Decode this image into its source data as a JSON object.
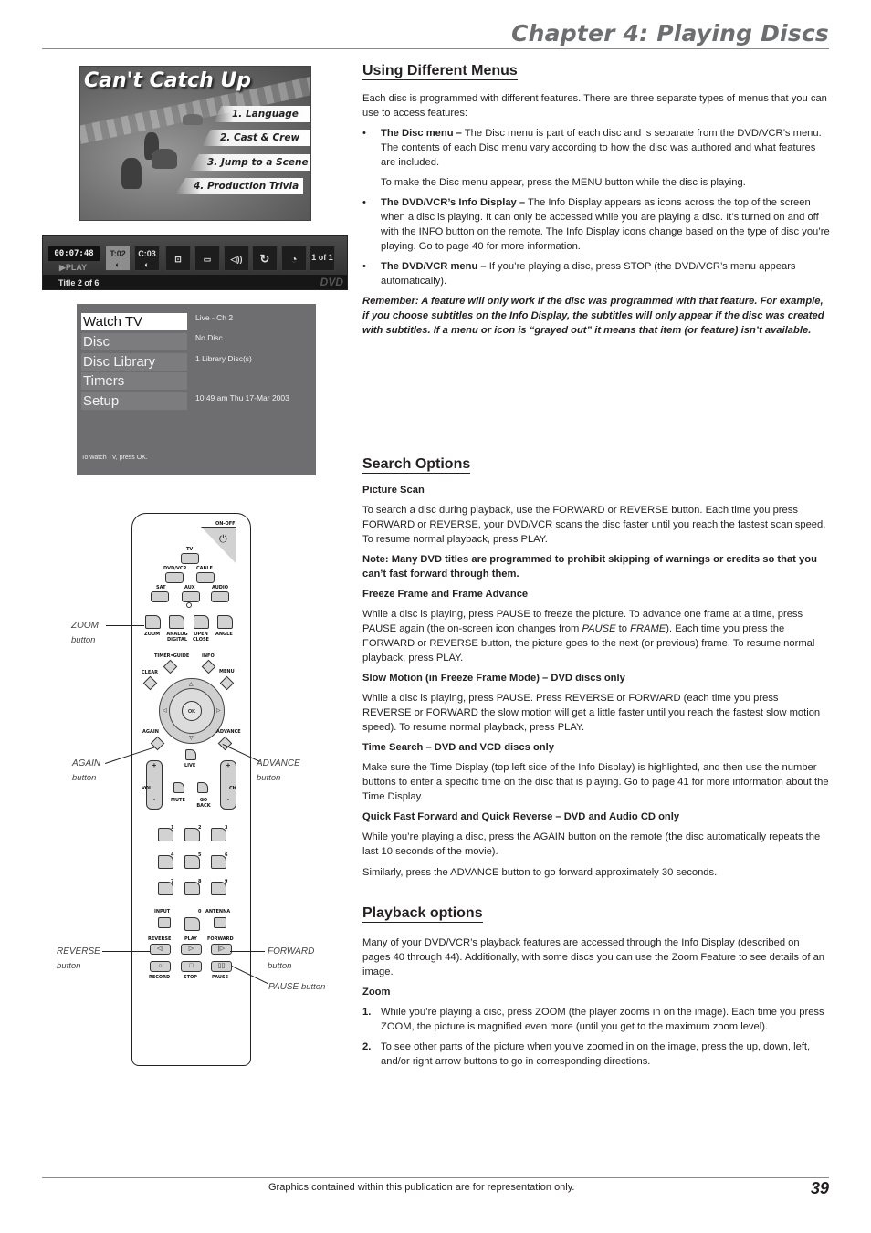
{
  "header": {
    "chapter_title": "Chapter 4: Playing Discs"
  },
  "disc_menu_image": {
    "title": "Can't Catch Up",
    "options": [
      "1. Language",
      "2. Cast & Crew",
      "3. Jump to a Scene",
      "4. Production Trivia"
    ]
  },
  "info_display_image": {
    "time": "00:07:48",
    "play_status": "▶PLAY",
    "title_chip": "T:02",
    "chapter_chip": "C:03",
    "angle_chip": "1 of 1",
    "footer_title": "Title 2 of 6",
    "logo": "DVD",
    "icons": [
      "title-icon",
      "chapter-icon",
      "zoom-icon",
      "subtitle-icon",
      "audio-icon",
      "repeat-icon",
      "timer-icon",
      "angle-icon"
    ]
  },
  "main_menu_image": {
    "items": [
      {
        "label": "Watch TV",
        "value": "Live - Ch 2",
        "active": true
      },
      {
        "label": "Disc",
        "value": "No Disc"
      },
      {
        "label": "Disc Library",
        "value": "1 Library Disc(s)"
      },
      {
        "label": "Timers",
        "value": ""
      },
      {
        "label": "Setup",
        "value": "10:49 am Thu 17-Mar 2003"
      }
    ],
    "hint": "To watch TV, press OK."
  },
  "remote": {
    "labels": {
      "on_off": "ON-OFF",
      "tv": "TV",
      "dvd_vcr": "DVD/VCR",
      "cable": "CABLE",
      "sat": "SAT",
      "aux": "AUX",
      "audio": "AUDIO",
      "zoom": "ZOOM",
      "analog_digital": "ANALOG DIGITAL",
      "open_close": "OPEN CLOSE",
      "angle": "ANGLE",
      "timer_guide": "TIMER•GUIDE",
      "info": "INFO",
      "clear": "CLEAR",
      "menu": "MENU",
      "ok": "OK",
      "again": "AGAIN",
      "advance": "ADVANCE",
      "live": "LIVE",
      "vol": "VOL",
      "ch": "CH",
      "mute": "MUTE",
      "go_back": "GO BACK",
      "input": "INPUT",
      "antenna": "ANTENNA",
      "reverse": "REVERSE",
      "play": "PLAY",
      "forward": "FORWARD",
      "record": "RECORD",
      "stop": "STOP",
      "pause": "PAUSE",
      "plus": "+",
      "minus": "-"
    },
    "digits": [
      "1",
      "2",
      "3",
      "4",
      "5",
      "6",
      "7",
      "8",
      "9",
      "0"
    ],
    "callouts": {
      "zoom": "ZOOM",
      "again": "AGAIN",
      "advance": "ADVANCE",
      "reverse": "REVERSE",
      "forward": "FORWARD",
      "pause": "PAUSE",
      "button_word": "button"
    }
  },
  "content": {
    "menus": {
      "heading": "Using Different Menus",
      "intro": "Each disc is programmed with different features. There are three separate types of menus that you can use to access features:",
      "bullets": [
        {
          "lead": "The Disc menu –",
          "text": " The Disc menu is part of each disc and is separate from the DVD/VCR’s menu. The contents of each Disc menu vary according to how the disc was authored and what features are included."
        },
        {
          "lead": "The DVD/VCR’s Info Display –",
          "text": " The Info Display appears as icons across the top of the screen when a disc is playing. It can only be accessed while you are playing a disc. It’s turned on and off with the INFO button on the remote. The Info Display icons change based on the type of disc you’re playing. Go to page 40 for more information."
        },
        {
          "lead": "The DVD/VCR menu –",
          "text": " If you’re playing a disc, press STOP (the DVD/VCR’s menu appears automatically)."
        }
      ],
      "disc_menu_followup": "To make the Disc menu appear, press the MENU button while the disc is playing.",
      "remember": "Remember: A feature will only work if the disc was programmed with that feature. For example, if you choose subtitles on the Info Display, the subtitles will only appear if the disc was created with subtitles. If a menu or icon is “grayed out” it means that item (or feature) isn’t available."
    },
    "search": {
      "heading": "Search Options",
      "picture_scan_title": "Picture Scan",
      "picture_scan_text": "To search a disc during playback, use the FORWARD or REVERSE button. Each time you press FORWARD or REVERSE, your DVD/VCR scans the disc faster until you reach the fastest scan speed. To resume normal playback, press PLAY.",
      "note": "Note: Many DVD titles are programmed to prohibit skipping of warnings or credits so that you can’t fast forward through them.",
      "freeze_title": "Freeze Frame and Frame Advance",
      "freeze_text_1": "While a disc is playing, press PAUSE to freeze the picture. To advance one frame at a time, press PAUSE again (the on-screen icon changes from ",
      "freeze_italic_1": "PAUSE",
      "freeze_text_2": " to ",
      "freeze_italic_2": "FRAME",
      "freeze_text_3": "). Each time you press the FORWARD or REVERSE button, the picture goes to the next (or previous) frame. To resume normal playback, press PLAY.",
      "slow_title": "Slow Motion (in Freeze Frame Mode) – DVD discs only",
      "slow_text": "While a disc is playing, press PAUSE. Press REVERSE or FORWARD (each time you press REVERSE or FORWARD the slow motion will get a little faster until you reach the fastest slow motion speed). To resume normal playback, press PLAY.",
      "time_title": "Time Search – DVD and VCD discs only",
      "time_text": "Make sure the Time Display (top left side of the Info Display) is highlighted, and then use the number buttons to enter a specific time on the disc that is playing. Go to page 41 for more information about the Time Display.",
      "quick_title": "Quick Fast Forward and Quick Reverse – DVD and Audio CD only",
      "quick_text": "While you’re playing a disc, press the AGAIN button on the remote (the disc automatically repeats the last 10 seconds of the movie).",
      "advance_text": "Similarly, press the ADVANCE button to go forward approximately 30 seconds."
    },
    "playback": {
      "heading": "Playback options",
      "intro": "Many of your DVD/VCR’s playback features are accessed through the Info Display (described on pages 40 through 44). Additionally, with some discs you can use the Zoom Feature to see details of an image.",
      "zoom_title": "Zoom",
      "steps": [
        {
          "num": "1.",
          "text": "While you’re playing a disc, press ZOOM (the player zooms in on the image). Each time you press ZOOM, the picture is magnified even more (until you get to the maximum zoom level)."
        },
        {
          "num": "2.",
          "text": "To see other parts of the picture when you’ve zoomed in on the image, press the up, down, left, and/or right arrow buttons to go in corresponding directions."
        }
      ]
    }
  },
  "footer": {
    "note": "Graphics contained within this publication are for representation only.",
    "page_number": "39"
  }
}
